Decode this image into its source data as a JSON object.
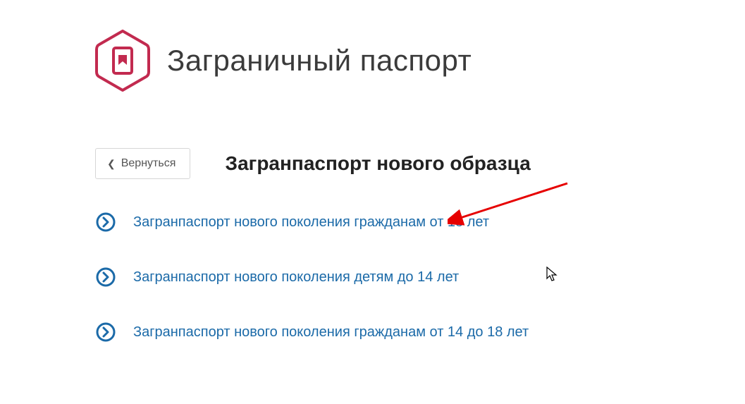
{
  "header": {
    "title": "Заграничный паспорт"
  },
  "back_button": {
    "label": "Вернуться"
  },
  "section": {
    "title": "Загранпаспорт нового образца"
  },
  "options": [
    {
      "label": "Загранпаспорт нового поколения гражданам от 18 лет"
    },
    {
      "label": "Загранпаспорт нового поколения детям до 14 лет"
    },
    {
      "label": "Загранпаспорт нового поколения гражданам от 14 до 18 лет"
    }
  ]
}
